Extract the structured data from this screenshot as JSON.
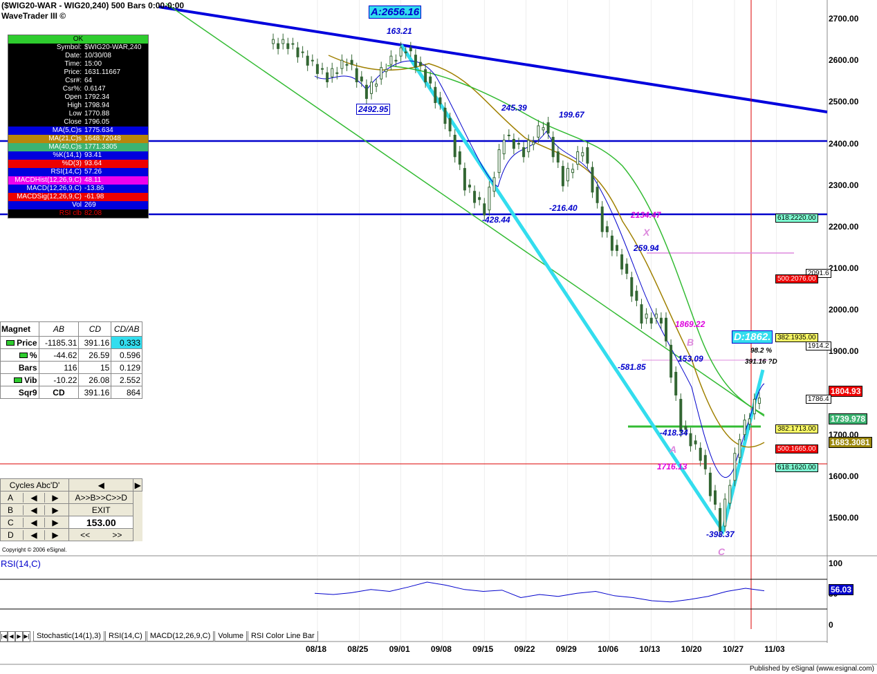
{
  "window": {
    "title": "($WIG20-WAR - WIG20,240) 500 Bars 0:00-0:00",
    "app_name": "WaveTrader III ©"
  },
  "info_panel": {
    "status": "OK",
    "rows": [
      {
        "k": "Symbol:",
        "v": "$WIG20-WAR,240",
        "bg": "#000",
        "fg": "#fff"
      },
      {
        "k": "Date:",
        "v": "10/30/08",
        "bg": "#000",
        "fg": "#fff"
      },
      {
        "k": "Time:",
        "v": "15:00",
        "bg": "#000",
        "fg": "#fff"
      },
      {
        "k": "Price:",
        "v": "1631.11667",
        "bg": "#000",
        "fg": "#fff"
      },
      {
        "k": "Csr#:",
        "v": "64",
        "bg": "#000",
        "fg": "#fff"
      },
      {
        "k": "Csr%:",
        "v": "0.6147",
        "bg": "#000",
        "fg": "#fff"
      },
      {
        "k": "Open",
        "v": "1792.34",
        "bg": "#000",
        "fg": "#fff"
      },
      {
        "k": "High",
        "v": "1798.94",
        "bg": "#000",
        "fg": "#fff"
      },
      {
        "k": "Low",
        "v": "1770.88",
        "bg": "#000",
        "fg": "#fff"
      },
      {
        "k": "Close",
        "v": "1796.05",
        "bg": "#000",
        "fg": "#fff"
      },
      {
        "k": "MA(5,C)s",
        "v": "1775.634",
        "bg": "#0000dd",
        "fg": "#fff"
      },
      {
        "k": "MA(21,C)s",
        "v": "1648.72048",
        "bg": "#b8860b",
        "fg": "#fff"
      },
      {
        "k": "MA(40,C)s",
        "v": "1771.3305",
        "bg": "#3cb371",
        "fg": "#fff"
      },
      {
        "k": "%K(14,1)",
        "v": "93.41",
        "bg": "#0000dd",
        "fg": "#fff"
      },
      {
        "k": "%D(3)",
        "v": "93.64",
        "bg": "#ee0000",
        "fg": "#fff"
      },
      {
        "k": "RSI(14,C)",
        "v": "57.26",
        "bg": "#0000dd",
        "fg": "#fff"
      },
      {
        "k": "MACDHist(12,26,9,C)",
        "v": "48.11",
        "bg": "#ee00ee",
        "fg": "#fff"
      },
      {
        "k": "MACD(12,26,9,C)",
        "v": "-13.86",
        "bg": "#0000dd",
        "fg": "#fff"
      },
      {
        "k": "MACDSig(12,26,9,C)",
        "v": "-61.98",
        "bg": "#ee0000",
        "fg": "#fff"
      },
      {
        "k": "Vol",
        "v": "269",
        "bg": "#0000dd",
        "fg": "#fff"
      },
      {
        "k": "RSI clb",
        "v": "82.08",
        "bg": "#000",
        "fg": "#ee0000"
      }
    ]
  },
  "magnet": {
    "title": "Magnet",
    "cols": [
      "AB",
      "CD",
      "CD/AB"
    ],
    "rows": [
      {
        "label": "Price",
        "marker": true,
        "ab": "-1185.31",
        "cd": "391.16",
        "ratio": "0.333",
        "hl": true
      },
      {
        "label": "%",
        "marker": true,
        "ab": "-44.62",
        "cd": "26.59",
        "ratio": "0.596",
        "hl": false
      },
      {
        "label": "Bars",
        "marker": false,
        "ab": "116",
        "cd": "15",
        "ratio": "0.129",
        "hl": false
      },
      {
        "label": "Vib",
        "marker": true,
        "ab": "-10.22",
        "cd": "26.08",
        "ratio": "2.552",
        "hl": false
      }
    ],
    "sqr9": {
      "label": "Sqr9",
      "cd": "CD",
      "val1": "391.16",
      "val2": "864"
    }
  },
  "cycles": {
    "title": "Cycles Abc'D'",
    "prev": "◀",
    "next": "▶",
    "rows": [
      "A",
      "B",
      "C",
      "D"
    ],
    "abcd_button": "A>>B>>C>>D",
    "exit_button": "EXIT",
    "value": "153.00",
    "rewind": "<<",
    "forward": ">>"
  },
  "copyright": "Copyright © 2006 eSignal.",
  "price_axis": [
    "2700.00",
    "2600.00",
    "2500.00",
    "2400.00",
    "2300.00",
    "2200.00",
    "2100.00",
    "2000.00",
    "1900.00",
    "1800.00",
    "1700.00",
    "1600.00",
    "1500.00"
  ],
  "date_axis": [
    "08/18",
    "08/25",
    "09/01",
    "09/08",
    "09/15",
    "09/22",
    "09/29",
    "10/06",
    "10/13",
    "10/20",
    "10/27",
    "11/03"
  ],
  "right_tags": [
    {
      "text": "618:2220.00",
      "bg": "#7fffd4"
    },
    {
      "text": "2091.6",
      "bg": "#fff"
    },
    {
      "text": "500:2076.00",
      "bg": "#ee0000",
      "fg": "#fff"
    },
    {
      "text": "382:1935.00",
      "bg": "#ffff66"
    },
    {
      "text": "1914.2",
      "bg": "#fff"
    },
    {
      "text": "1804.93",
      "bg": "#ee0000",
      "fg": "#fff"
    },
    {
      "text": "1786.4",
      "bg": "#fff"
    },
    {
      "text": "1739.978",
      "bg": "#3cb371",
      "fg": "#fff"
    },
    {
      "text": "382:1713.00",
      "bg": "#ffff66"
    },
    {
      "text": "1683.3081",
      "bg": "#9b870c",
      "fg": "#fff"
    },
    {
      "text": "500:1665.00",
      "bg": "#ee0000",
      "fg": "#fff"
    },
    {
      "text": "618:1620.00",
      "bg": "#7fffd4"
    }
  ],
  "annotations": {
    "a_top": "A:2656.16",
    "d_box": "D:1862.",
    "p163": "163.21",
    "p2492": "2492.95",
    "p245": "245.39",
    "p199": "199.67",
    "n428": "-428.44",
    "n216": "-216.40",
    "p2134": "2134.47",
    "x": "X",
    "p259": "259.94",
    "p1869": "1869.22",
    "b": "B",
    "n581": "-581.85",
    "p153": "153.09",
    "pct98": "98.2 %",
    "d391": "391.16 ?D",
    "n418": "-418.34",
    "a_low": "A",
    "p1716": "1716.13",
    "n398": "-398.37",
    "c": "C"
  },
  "rsi_panel": {
    "title": "RSI(14,C)",
    "axis": [
      "100",
      "50",
      "0"
    ],
    "value_tag": "56.03"
  },
  "tabs": [
    "Stochastic(14(1),3)",
    "RSI(14,C)",
    "MACD(12,26,9,C)",
    "Volume",
    "RSI Color Line Bar"
  ],
  "footer": "Published by eSignal (www.esignal.com)",
  "chart_data": {
    "type": "candlestick",
    "title": "($WIG20-WAR - WIG20,240) 500 Bars 0:00-0:00",
    "xlabel": "",
    "ylabel": "",
    "ylim": [
      1420,
      2760
    ],
    "x_ticks": [
      "08/18",
      "08/25",
      "09/01",
      "09/08",
      "09/15",
      "09/22",
      "09/29",
      "10/06",
      "10/13",
      "10/20",
      "10/27",
      "11/03"
    ],
    "closes_approx": [
      2640,
      2600,
      2560,
      2600,
      2520,
      2590,
      2630,
      2560,
      2460,
      2300,
      2240,
      2420,
      2380,
      2450,
      2310,
      2390,
      2200,
      2110,
      1980,
      1980,
      1720,
      1650,
      1480,
      1700,
      1800
    ],
    "horizontal_levels": [
      2400,
      2220,
      1630
    ],
    "rsi_series_approx": [
      52,
      50,
      53,
      58,
      55,
      62,
      70,
      65,
      58,
      55,
      57,
      45,
      50,
      47,
      52,
      55,
      48,
      45,
      40,
      38,
      42,
      47,
      55,
      60,
      56
    ]
  }
}
